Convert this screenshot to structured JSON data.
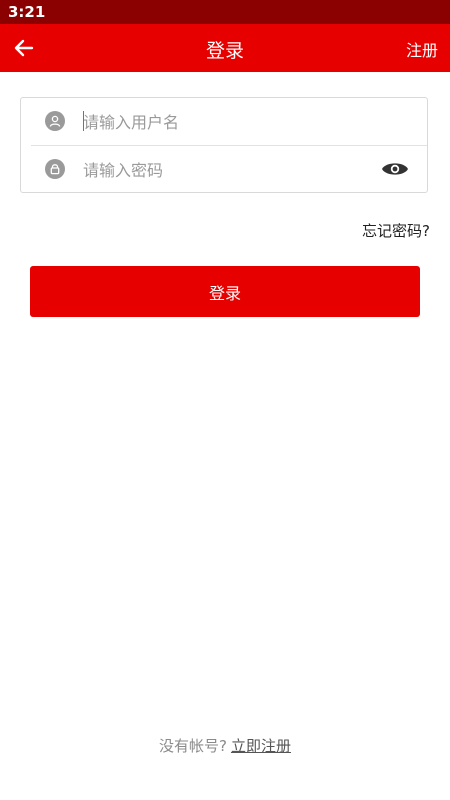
{
  "status_bar": {
    "time": "3:21"
  },
  "app_bar": {
    "title": "登录",
    "register_label": "注册",
    "back_icon": "arrow-left-icon"
  },
  "form": {
    "username": {
      "placeholder": "请输入用户名",
      "value": "",
      "icon": "user-icon"
    },
    "password": {
      "placeholder": "请输入密码",
      "value": "",
      "icon": "lock-icon",
      "visibility_icon": "eye-icon"
    }
  },
  "forgot_password_label": "忘记密码?",
  "login_button_label": "登录",
  "footer": {
    "prompt": "没有帐号?",
    "register_link": "立即注册"
  },
  "colors": {
    "status_bar": "#8b0000",
    "primary": "#e60000",
    "icon_gray": "#9a9a9a"
  }
}
